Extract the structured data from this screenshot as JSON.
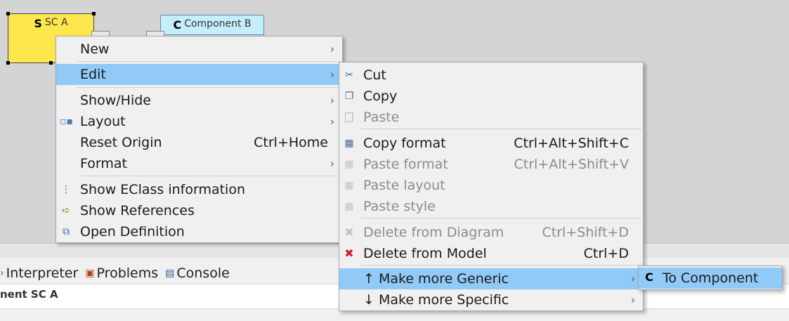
{
  "diagram": {
    "node_a": {
      "glyph": "S",
      "label": "SC A"
    },
    "node_b": {
      "glyph": "C",
      "label": "Component B"
    },
    "node_a_color": "#fde74c",
    "node_b_color": "#c4eef9"
  },
  "panel": {
    "tabs": [
      {
        "label": "Interpreter",
        "icon": "interpreter-icon"
      },
      {
        "label": "Problems",
        "icon": "problems-icon"
      },
      {
        "label": "Console",
        "icon": "console-icon"
      }
    ],
    "title": "nent SC A"
  },
  "main_menu": {
    "items": [
      {
        "label": "New",
        "submenu": true
      },
      {
        "label": "Edit",
        "submenu": true,
        "highlighted": true
      },
      {
        "label": "Show/Hide",
        "submenu": true
      },
      {
        "label": "Layout",
        "submenu": true,
        "icon": "layout-icon"
      },
      {
        "label": "Reset Origin",
        "shortcut": "Ctrl+Home"
      },
      {
        "label": "Format",
        "submenu": true
      },
      {
        "label": "Show EClass information",
        "icon": "eclass-info-icon"
      },
      {
        "label": "Show References",
        "icon": "references-icon"
      },
      {
        "label": "Open Definition",
        "icon": "open-definition-icon"
      }
    ]
  },
  "edit_menu": {
    "items": [
      {
        "label": "Cut",
        "icon": "scissors-icon"
      },
      {
        "label": "Copy",
        "icon": "copy-icon"
      },
      {
        "label": "Paste",
        "icon": "paste-icon",
        "disabled": true
      },
      {
        "label": "Copy format",
        "shortcut": "Ctrl+Alt+Shift+C",
        "icon": "copy-format-icon"
      },
      {
        "label": "Paste format",
        "shortcut": "Ctrl+Alt+Shift+V",
        "icon": "paste-format-icon",
        "disabled": true
      },
      {
        "label": "Paste layout",
        "icon": "paste-layout-icon",
        "disabled": true
      },
      {
        "label": "Paste style",
        "icon": "paste-style-icon",
        "disabled": true
      },
      {
        "label": "Delete from Diagram",
        "shortcut": "Ctrl+Shift+D",
        "icon": "delete-diagram-icon",
        "disabled": true
      },
      {
        "label": "Delete from Model",
        "shortcut": "Ctrl+D",
        "icon": "delete-model-icon"
      },
      {
        "label": "↑ Make more Generic",
        "submenu": true,
        "highlighted": true
      },
      {
        "label": "↓ Make more Specific",
        "submenu": true
      }
    ]
  },
  "generic_menu": {
    "items": [
      {
        "label": "To Component",
        "glyph": "C",
        "highlighted": true
      }
    ]
  },
  "colors": {
    "highlight": "#91c9f7",
    "menu_bg": "#f0f0f0",
    "disabled_text": "#8c8c8c"
  }
}
